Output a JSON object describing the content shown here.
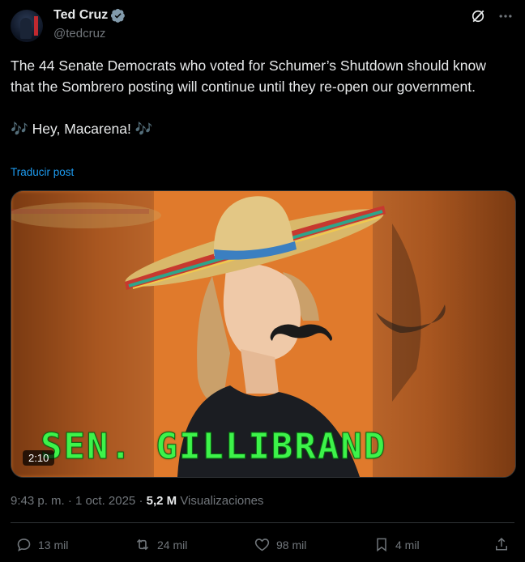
{
  "author": {
    "name": "Ted Cruz",
    "handle": "@tedcruz"
  },
  "tweet": {
    "text": "The 44 Senate Democrats who voted for Schumer’s Shutdown should know that the Sombrero posting will continue until they re-open our government.\n\n🎶 Hey, Macarena! 🎶",
    "translate_label": "Traducir post"
  },
  "media": {
    "duration": "2:10",
    "caption": "SEN. GILLIBRAND"
  },
  "meta": {
    "time": "9:43 p. m.",
    "date": "1 oct. 2025",
    "views_count": "5,2 M",
    "views_label": "Visualizaciones"
  },
  "actions": {
    "replies": "13 mil",
    "reposts": "24 mil",
    "likes": "98 mil",
    "bookmarks": "4 mil"
  },
  "colors": {
    "accent": "#1d9bf0",
    "background": "#000000",
    "secondary_text": "#71767b",
    "caption_green": "#3df34a"
  }
}
